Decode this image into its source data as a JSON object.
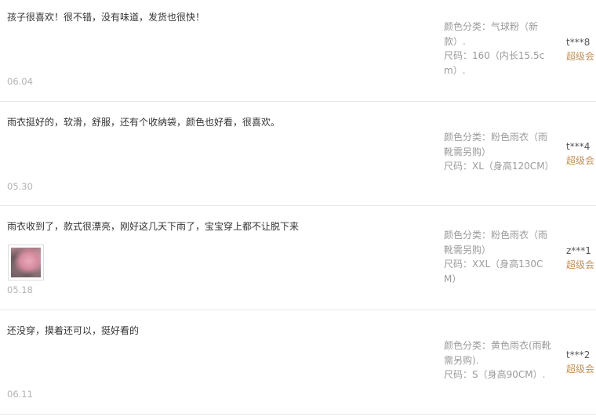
{
  "reviews": [
    {
      "content": "孩子很喜欢！很不错，没有味道，发货也很快！",
      "date": "06.04",
      "sku_line1": "颜色分类：气球粉（新款）.",
      "sku_line2": "尺码：160（内长15.5cm）.",
      "user": "t***8",
      "level": "超级会"
    },
    {
      "content": "雨衣挺好的，软滑，舒服，还有个收纳袋，颜色也好看，很喜欢。",
      "date": "05.30",
      "sku_line1": "颜色分类：粉色雨衣（雨靴需另购）",
      "sku_line2": "尺码：XL（身高120CM）",
      "user": "t***4",
      "level": "超级会"
    },
    {
      "content": "雨衣收到了，款式很漂亮，刚好这几天下雨了，宝宝穿上都不让脱下来",
      "date": "05.18",
      "sku_line1": "颜色分类：粉色雨衣（雨靴需另购）",
      "sku_line2": "尺码：XXL（身高130CM）",
      "user": "z***1",
      "level": "超级会"
    },
    {
      "content": "还没穿，摸着还可以，挺好看的",
      "date": "06.11",
      "sku_line1": "颜色分类：黄色雨衣(雨靴需另购).",
      "sku_line2": "尺码：S（身高90CM）.",
      "user": "t***2",
      "level": "超级会"
    }
  ]
}
